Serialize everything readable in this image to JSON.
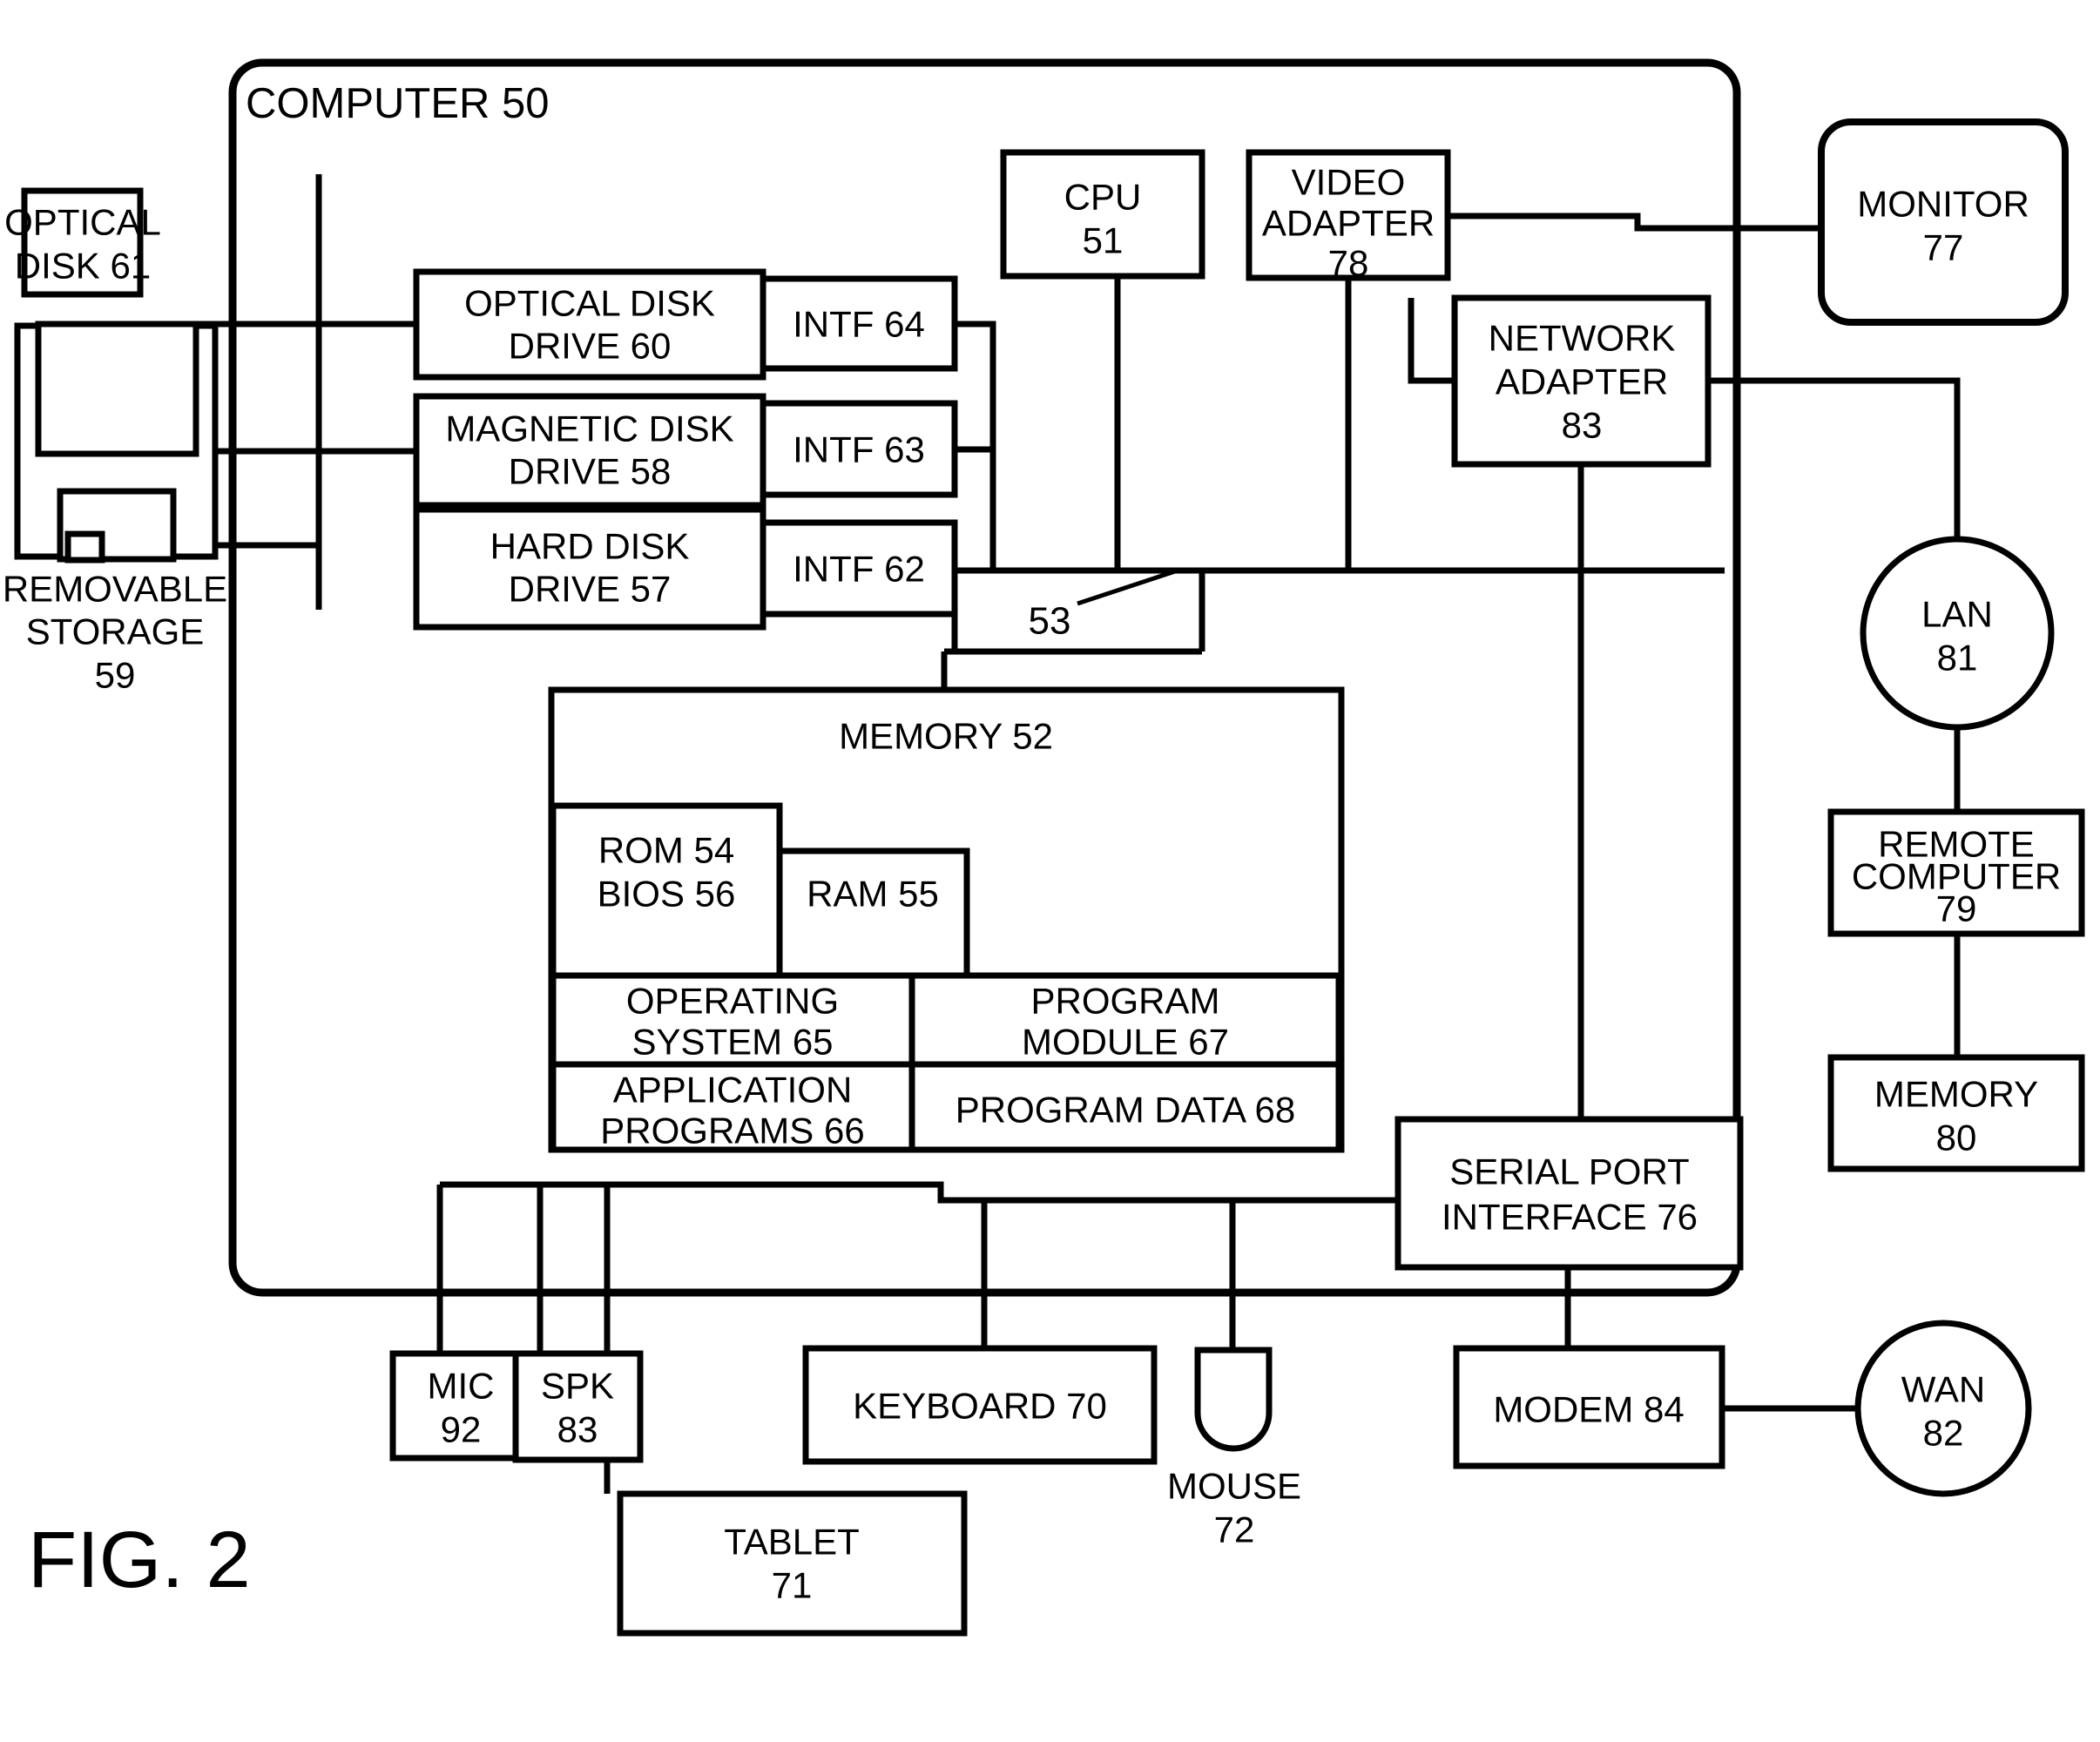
{
  "figure": {
    "caption": "FIG. 2",
    "system_title": "COMPUTER  50",
    "bus_ref": "53"
  },
  "nodes": {
    "optical_disk": {
      "line1": "OPTICAL",
      "line2": "DISK 61"
    },
    "removable_storage": {
      "line1": "REMOVABLE",
      "line2": "STORAGE",
      "line3": "59"
    },
    "optical_disk_drive": {
      "line1": "OPTICAL DISK",
      "line2": "DRIVE 60"
    },
    "magnetic_disk_drive": {
      "line1": "MAGNETIC DISK",
      "line2": "DRIVE 58"
    },
    "hard_disk_drive": {
      "line1": "HARD DISK",
      "line2": "DRIVE 57"
    },
    "intf64": {
      "line1": "INTF 64"
    },
    "intf63": {
      "line1": "INTF 63"
    },
    "intf62": {
      "line1": "INTF 62"
    },
    "cpu": {
      "line1": "CPU",
      "line2": "51"
    },
    "video_adapter": {
      "line1": "VIDEO",
      "line2": "ADAPTER",
      "line3": "78"
    },
    "monitor": {
      "line1": "MONITOR",
      "line2": "77"
    },
    "network_adapter": {
      "line1": "NETWORK",
      "line2": "ADAPTER",
      "line3": "83"
    },
    "lan": {
      "line1": "LAN",
      "line2": "81"
    },
    "remote_computer": {
      "line1": "REMOTE",
      "line2": "COMPUTER",
      "line3": "79"
    },
    "remote_memory": {
      "line1": "MEMORY",
      "line2": "80"
    },
    "memory": {
      "line1": "MEMORY 52"
    },
    "rom_bios": {
      "line1": "ROM 54",
      "line2": "BIOS 56"
    },
    "ram": {
      "line1": "RAM 55"
    },
    "operating_system": {
      "line1": "OPERATING",
      "line2": "SYSTEM 65"
    },
    "program_module": {
      "line1": "PROGRAM",
      "line2": "MODULE 67"
    },
    "application_programs": {
      "line1": "APPLICATION",
      "line2": "PROGRAMS 66"
    },
    "program_data": {
      "line1": "PROGRAM DATA 68"
    },
    "serial_port_interface": {
      "line1": "SERIAL PORT",
      "line2": "INTERFACE 76"
    },
    "mic": {
      "line1": "MIC",
      "line2": "92"
    },
    "spk": {
      "line1": "SPK",
      "line2": "83"
    },
    "keyboard": {
      "line1": "KEYBOARD 70"
    },
    "tablet": {
      "line1": "TABLET",
      "line2": "71"
    },
    "mouse": {
      "line1": "MOUSE",
      "line2": "72"
    },
    "modem": {
      "line1": "MODEM 84"
    },
    "wan": {
      "line1": "WAN",
      "line2": "82"
    }
  },
  "style": {
    "stroke": "#000000",
    "fill": "#ffffff"
  }
}
